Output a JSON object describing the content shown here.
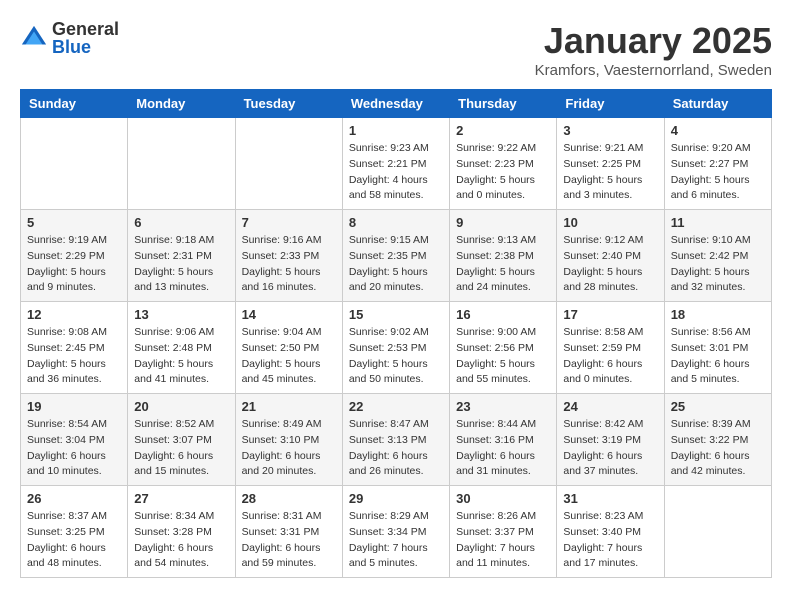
{
  "header": {
    "logo_general": "General",
    "logo_blue": "Blue",
    "month_title": "January 2025",
    "location": "Kramfors, Vaesternorrland, Sweden"
  },
  "days_of_week": [
    "Sunday",
    "Monday",
    "Tuesday",
    "Wednesday",
    "Thursday",
    "Friday",
    "Saturday"
  ],
  "weeks": [
    [
      {
        "day": "",
        "info": ""
      },
      {
        "day": "",
        "info": ""
      },
      {
        "day": "",
        "info": ""
      },
      {
        "day": "1",
        "info": "Sunrise: 9:23 AM\nSunset: 2:21 PM\nDaylight: 4 hours\nand 58 minutes."
      },
      {
        "day": "2",
        "info": "Sunrise: 9:22 AM\nSunset: 2:23 PM\nDaylight: 5 hours\nand 0 minutes."
      },
      {
        "day": "3",
        "info": "Sunrise: 9:21 AM\nSunset: 2:25 PM\nDaylight: 5 hours\nand 3 minutes."
      },
      {
        "day": "4",
        "info": "Sunrise: 9:20 AM\nSunset: 2:27 PM\nDaylight: 5 hours\nand 6 minutes."
      }
    ],
    [
      {
        "day": "5",
        "info": "Sunrise: 9:19 AM\nSunset: 2:29 PM\nDaylight: 5 hours\nand 9 minutes."
      },
      {
        "day": "6",
        "info": "Sunrise: 9:18 AM\nSunset: 2:31 PM\nDaylight: 5 hours\nand 13 minutes."
      },
      {
        "day": "7",
        "info": "Sunrise: 9:16 AM\nSunset: 2:33 PM\nDaylight: 5 hours\nand 16 minutes."
      },
      {
        "day": "8",
        "info": "Sunrise: 9:15 AM\nSunset: 2:35 PM\nDaylight: 5 hours\nand 20 minutes."
      },
      {
        "day": "9",
        "info": "Sunrise: 9:13 AM\nSunset: 2:38 PM\nDaylight: 5 hours\nand 24 minutes."
      },
      {
        "day": "10",
        "info": "Sunrise: 9:12 AM\nSunset: 2:40 PM\nDaylight: 5 hours\nand 28 minutes."
      },
      {
        "day": "11",
        "info": "Sunrise: 9:10 AM\nSunset: 2:42 PM\nDaylight: 5 hours\nand 32 minutes."
      }
    ],
    [
      {
        "day": "12",
        "info": "Sunrise: 9:08 AM\nSunset: 2:45 PM\nDaylight: 5 hours\nand 36 minutes."
      },
      {
        "day": "13",
        "info": "Sunrise: 9:06 AM\nSunset: 2:48 PM\nDaylight: 5 hours\nand 41 minutes."
      },
      {
        "day": "14",
        "info": "Sunrise: 9:04 AM\nSunset: 2:50 PM\nDaylight: 5 hours\nand 45 minutes."
      },
      {
        "day": "15",
        "info": "Sunrise: 9:02 AM\nSunset: 2:53 PM\nDaylight: 5 hours\nand 50 minutes."
      },
      {
        "day": "16",
        "info": "Sunrise: 9:00 AM\nSunset: 2:56 PM\nDaylight: 5 hours\nand 55 minutes."
      },
      {
        "day": "17",
        "info": "Sunrise: 8:58 AM\nSunset: 2:59 PM\nDaylight: 6 hours\nand 0 minutes."
      },
      {
        "day": "18",
        "info": "Sunrise: 8:56 AM\nSunset: 3:01 PM\nDaylight: 6 hours\nand 5 minutes."
      }
    ],
    [
      {
        "day": "19",
        "info": "Sunrise: 8:54 AM\nSunset: 3:04 PM\nDaylight: 6 hours\nand 10 minutes."
      },
      {
        "day": "20",
        "info": "Sunrise: 8:52 AM\nSunset: 3:07 PM\nDaylight: 6 hours\nand 15 minutes."
      },
      {
        "day": "21",
        "info": "Sunrise: 8:49 AM\nSunset: 3:10 PM\nDaylight: 6 hours\nand 20 minutes."
      },
      {
        "day": "22",
        "info": "Sunrise: 8:47 AM\nSunset: 3:13 PM\nDaylight: 6 hours\nand 26 minutes."
      },
      {
        "day": "23",
        "info": "Sunrise: 8:44 AM\nSunset: 3:16 PM\nDaylight: 6 hours\nand 31 minutes."
      },
      {
        "day": "24",
        "info": "Sunrise: 8:42 AM\nSunset: 3:19 PM\nDaylight: 6 hours\nand 37 minutes."
      },
      {
        "day": "25",
        "info": "Sunrise: 8:39 AM\nSunset: 3:22 PM\nDaylight: 6 hours\nand 42 minutes."
      }
    ],
    [
      {
        "day": "26",
        "info": "Sunrise: 8:37 AM\nSunset: 3:25 PM\nDaylight: 6 hours\nand 48 minutes."
      },
      {
        "day": "27",
        "info": "Sunrise: 8:34 AM\nSunset: 3:28 PM\nDaylight: 6 hours\nand 54 minutes."
      },
      {
        "day": "28",
        "info": "Sunrise: 8:31 AM\nSunset: 3:31 PM\nDaylight: 6 hours\nand 59 minutes."
      },
      {
        "day": "29",
        "info": "Sunrise: 8:29 AM\nSunset: 3:34 PM\nDaylight: 7 hours\nand 5 minutes."
      },
      {
        "day": "30",
        "info": "Sunrise: 8:26 AM\nSunset: 3:37 PM\nDaylight: 7 hours\nand 11 minutes."
      },
      {
        "day": "31",
        "info": "Sunrise: 8:23 AM\nSunset: 3:40 PM\nDaylight: 7 hours\nand 17 minutes."
      },
      {
        "day": "",
        "info": ""
      }
    ]
  ]
}
